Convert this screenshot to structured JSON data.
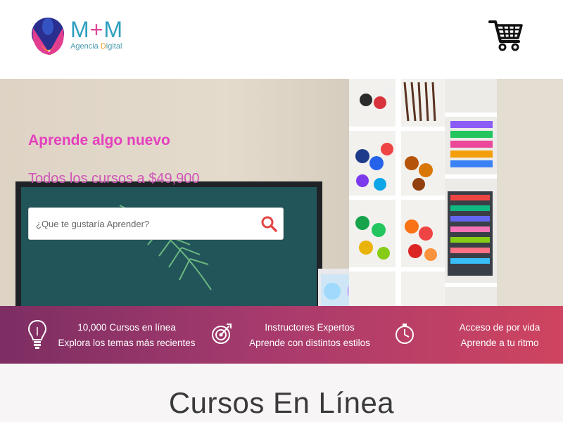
{
  "brand": {
    "name_left": "M",
    "name_plus": "+",
    "name_right": "M",
    "tagline_part1": "Agencia ",
    "tagline_part2": "D",
    "tagline_part3": "igital"
  },
  "header": {
    "cart_icon": "shopping-cart-icon"
  },
  "hero": {
    "title": "Aprende algo nuevo",
    "subtitle": "Todos los cursos a $49,900",
    "search_placeholder": "¿Que te gustaría Aprender?",
    "search_value": "",
    "search_icon": "search-icon",
    "title_color": "#e43fbd"
  },
  "features": [
    {
      "icon": "lightbulb-icon",
      "line1": "10,000 Cursos en línea",
      "line2": "Explora los temas más recientes"
    },
    {
      "icon": "target-icon",
      "line1": "Instructores Expertos",
      "line2": "Aprende con distintos estilos"
    },
    {
      "icon": "clock-icon",
      "line1": "Acceso de por vida",
      "line2": "Aprende a tu ritmo"
    }
  ],
  "section": {
    "title": "Cursos En Línea"
  },
  "colors": {
    "accent_pink": "#e43fbd",
    "band_start": "#7d2e63",
    "band_end": "#cf4460"
  }
}
